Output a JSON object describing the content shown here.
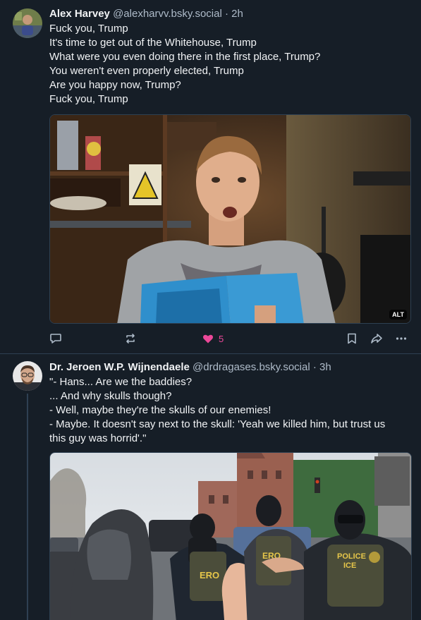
{
  "posts": [
    {
      "author": "Alex Harvey",
      "handle": "@alexharvv.bsky.social",
      "separator": "·",
      "time": "2h",
      "lines": [
        "Fuck you, Trump",
        "It's time to get out of the Whitehouse, Trump",
        "What were you even doing there in the first place, Trump?",
        "You weren't even properly elected, Trump",
        "Are you happy now, Trump?",
        "Fuck you, Trump"
      ],
      "media_alt_badge": "ALT",
      "like_count": "5",
      "icons": [
        "reply-icon",
        "repost-icon",
        "heart-icon",
        "bookmark-icon",
        "share-icon",
        "more-icon"
      ]
    },
    {
      "author": "Dr. Jeroen W.P. Wijnendaele",
      "handle": "@drdragases.bsky.social",
      "separator": "·",
      "time": "3h",
      "lines": [
        "\"- Hans... Are we the baddies?",
        "... And why skulls though?",
        "- Well, maybe they're the skulls of our enemies!",
        "- Maybe. It doesn't say next to the skull: 'Yeah we killed him, but trust us",
        "this guy was horrid'.\""
      ],
      "vest_labels": [
        "ERO",
        "POLICE",
        "ICE",
        "ERO"
      ]
    }
  ],
  "colors": {
    "background": "#161e27",
    "border": "#2e4052",
    "muted": "#aebbc9",
    "like": "#ec4899"
  }
}
